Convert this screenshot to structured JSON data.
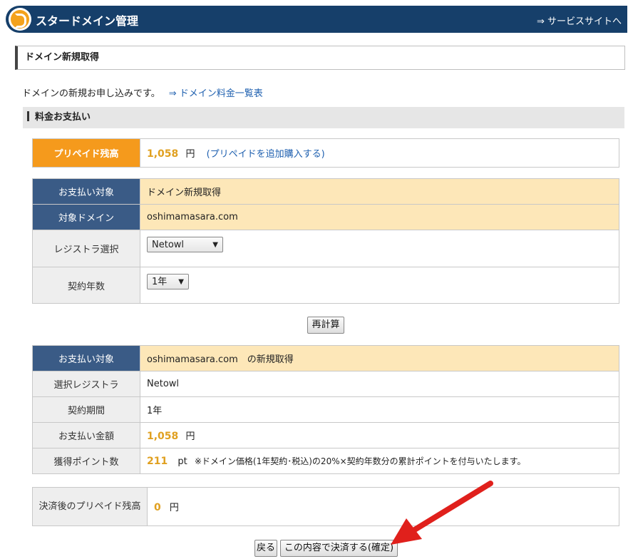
{
  "header": {
    "title": "スタードメイン管理",
    "service_link": "⇒ サービスサイトへ"
  },
  "section_title": "ドメイン新規取得",
  "intro": {
    "text": "ドメインの新規お申し込みです。",
    "price_link": "⇒ ドメイン料金一覧表"
  },
  "payment_heading": "料金お支払い",
  "prepaid": {
    "label": "プリペイド残高",
    "amount": "1,058",
    "unit": "円",
    "purchase_link": "(プリペイドを追加購入する)"
  },
  "form": {
    "target_label": "お支払い対象",
    "target_value": "ドメイン新規取得",
    "domain_label": "対象ドメイン",
    "domain_value": "oshimamasara.com",
    "registrar_label": "レジストラ選択",
    "registrar_value": "Netowl",
    "years_label": "契約年数",
    "years_value": "1年"
  },
  "recalc_button": "再計算",
  "summary": {
    "target_label": "お支払い対象",
    "target_value": "oshimamasara.com　の新規取得",
    "registrar_label": "選択レジストラ",
    "registrar_value": "Netowl",
    "period_label": "契約期間",
    "period_value": "1年",
    "amount_label": "お支払い金額",
    "amount_value": "1,058",
    "amount_unit": "円",
    "points_label": "獲得ポイント数",
    "points_value": "211",
    "points_unit": "pt",
    "points_note": "※ドメイン価格(1年契約･税込)の20%×契約年数分の累計ポイントを付与いたします。"
  },
  "after": {
    "label": "決済後のプリペイド残高",
    "amount": "0",
    "unit": "円"
  },
  "buttons": {
    "back": "戻る",
    "confirm": "この内容で決済する(確定)"
  },
  "colors": {
    "header_bg": "#163f6a",
    "prepaid_label_bg": "#f59a1c",
    "table_header_blue": "#3a5b86",
    "highlight_yellow": "#fde7b8",
    "amount_orange": "#e0a020",
    "annotation_arrow": "#e0201c"
  }
}
